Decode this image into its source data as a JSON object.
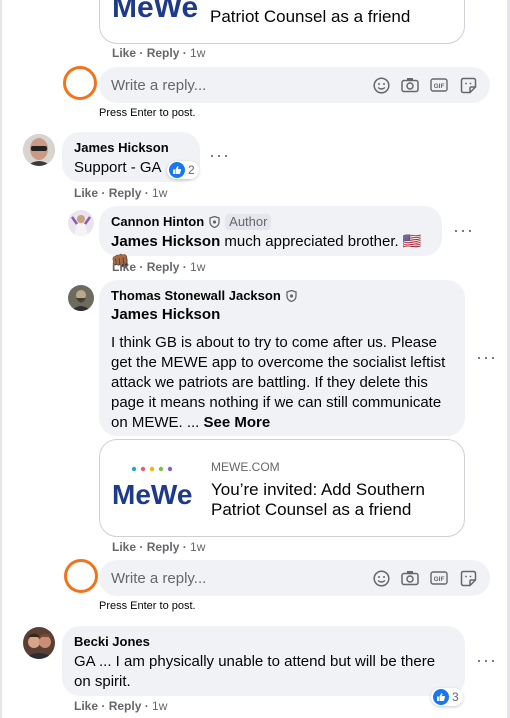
{
  "colors": {
    "bubble": "#f0f2f5",
    "meta": "#65676b",
    "accent_circle": "#f2731c",
    "like_blue": "#1877f2",
    "mewe_blue": "#1e3a8a"
  },
  "top_card": {
    "brand": "MeWe",
    "title_line2": "Patriot Counsel as a friend"
  },
  "actions": {
    "like": "Like",
    "reply": "Reply",
    "sep": " · "
  },
  "top_actions": {
    "time": "1w"
  },
  "reply_box": {
    "placeholder": "Write a reply...",
    "hint": "Press Enter to post.",
    "icons": [
      "emoji-icon",
      "camera-icon",
      "gif-icon",
      "sticker-icon"
    ],
    "gif_text": "GIF"
  },
  "comments": [
    {
      "author": "James Hickson",
      "text": "Support - GA",
      "reactions": "2",
      "time": "1w"
    },
    {
      "author": "Cannon Hinton",
      "badge": "Author",
      "mention": "James Hickson",
      "text": "much appreciated brother. 🇺🇸👊🏾",
      "time": "1w"
    },
    {
      "author": "Thomas Stonewall Jackson",
      "mention": "James Hickson",
      "text": "I think GB is about to try to come after us. Please get the MEWE app to overcome the socialist leftist attack we patriots are battling. If they delete this page it means nothing if we can still communicate on MEWE. ...",
      "see_more": "See More",
      "time": "1w",
      "card": {
        "domain": "MEWE.COM",
        "brand": "MeWe",
        "title": "You’re invited: Add Southern Patriot Counsel as a friend"
      }
    },
    {
      "author": "Becki Jones",
      "text": "GA ... I am physically unable to attend but will be there on spirit.",
      "reactions": "3",
      "time": "1w"
    }
  ]
}
